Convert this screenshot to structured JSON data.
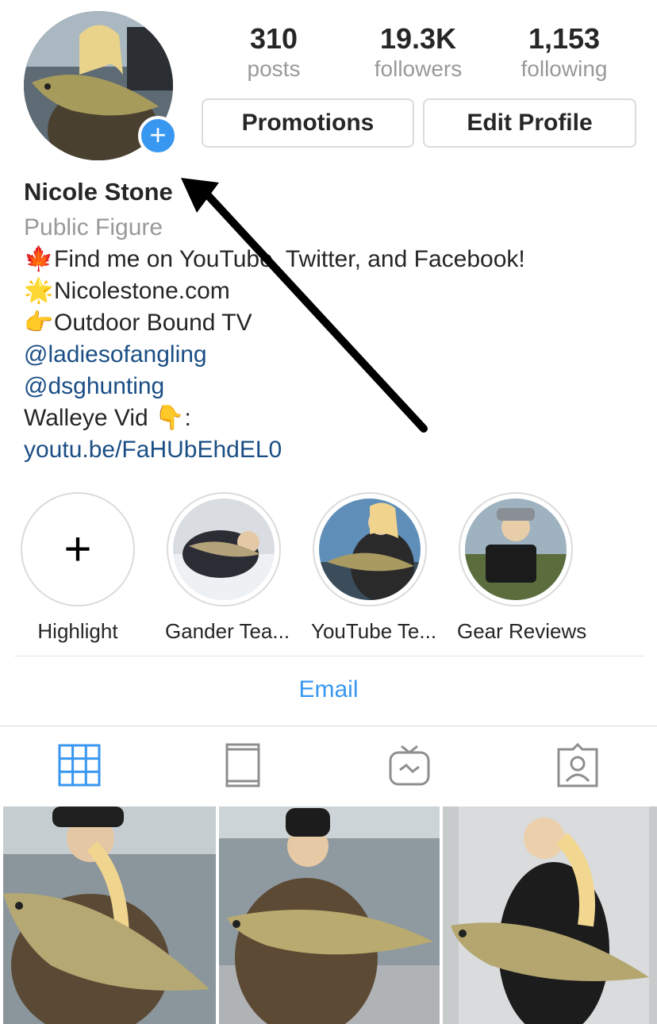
{
  "profile": {
    "stats": [
      {
        "value": "310",
        "label": "posts"
      },
      {
        "value": "19.3K",
        "label": "followers"
      },
      {
        "value": "1,153",
        "label": "following"
      }
    ],
    "buttons": {
      "promotions": "Promotions",
      "edit_profile": "Edit Profile"
    },
    "add_story_icon": "+",
    "name": "Nicole Stone",
    "category": "Public Figure",
    "bio": [
      {
        "emoji": "🍁",
        "text": "Find me on YouTube, Twitter, and Facebook!"
      },
      {
        "emoji": "🌟",
        "text": "Nicolestone.com"
      },
      {
        "emoji": "👉",
        "text": "Outdoor Bound TV"
      }
    ],
    "mentions": [
      "@ladiesofangling",
      "@dsghunting"
    ],
    "walleye_text": "Walleye Vid",
    "walleye_emoji": "👇",
    "walleye_colon": ":",
    "link": "youtu.be/FaHUbEhdEL0"
  },
  "highlights": [
    {
      "label": "Highlight",
      "icon": "plus"
    },
    {
      "label": "Gander Tea..."
    },
    {
      "label": "YouTube Te..."
    },
    {
      "label": "Gear Reviews"
    }
  ],
  "contact": {
    "email": "Email"
  },
  "tabs": [
    "grid-icon",
    "feed-icon",
    "igtv-icon",
    "tagged-icon"
  ],
  "colors": {
    "accent": "#3897f0",
    "link": "#1a4e85",
    "muted": "#999999",
    "border": "#dbdbdb"
  }
}
